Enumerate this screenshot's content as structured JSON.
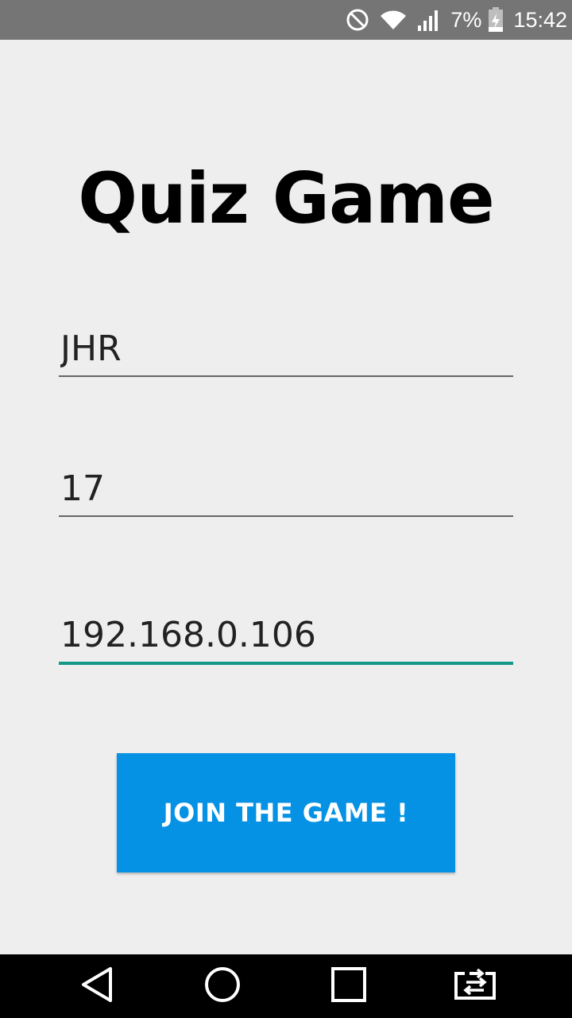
{
  "status_bar": {
    "battery_percent": "7%",
    "time": "15:42",
    "icons": [
      "do-not-disturb-icon",
      "wifi-icon",
      "cell-signal-icon",
      "battery-charging-icon"
    ]
  },
  "title": "Quiz Game",
  "form": {
    "name_value": "JHR",
    "number_value": "17",
    "ip_value": "192.168.0.106"
  },
  "join_button_label": "JOIN THE GAME !",
  "nav_bar": {
    "icons": [
      "back-icon",
      "home-icon",
      "recents-icon",
      "screen-share-icon"
    ]
  },
  "colors": {
    "accent": "#129886",
    "button": "#0592e4",
    "status_bar": "#757575",
    "background": "#eeeeee"
  }
}
